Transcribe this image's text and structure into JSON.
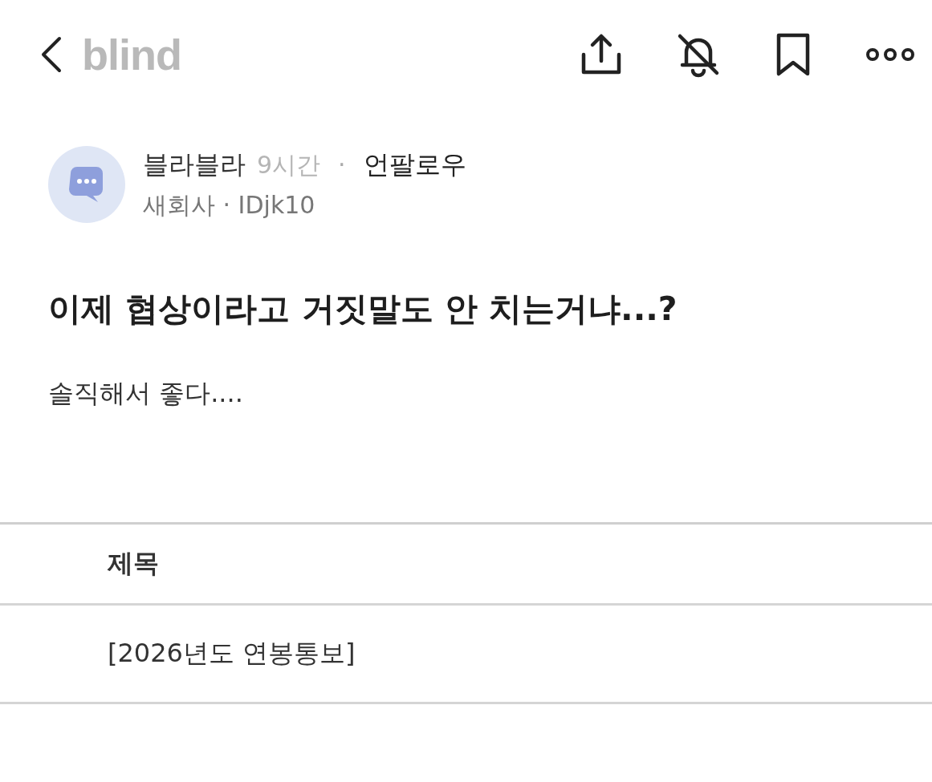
{
  "header": {
    "logo": "blind"
  },
  "author": {
    "name": "블라블라",
    "time": "9시간",
    "separator": "·",
    "follow": "언팔로우",
    "company": "새회사 · IDjk10"
  },
  "post": {
    "title": "이제 협상이라고 거짓말도 안 치는거냐...?",
    "body": "솔직해서 좋다...."
  },
  "attachment": {
    "rows": [
      {
        "kind": "header",
        "text": "제목"
      },
      {
        "kind": "cell",
        "text": "[2026년도 연봉통보]"
      }
    ]
  }
}
